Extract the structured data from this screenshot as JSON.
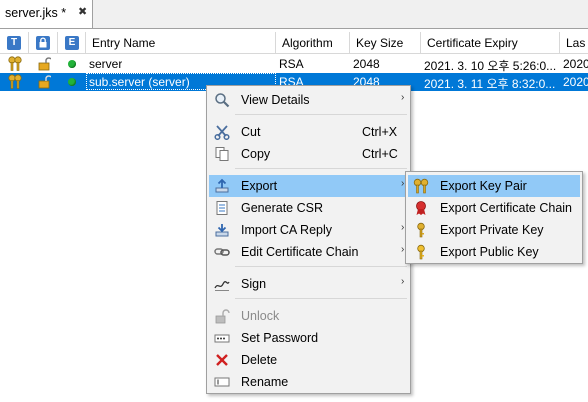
{
  "tab": {
    "title": "server.jks *",
    "close_glyph": "✖"
  },
  "columns": {
    "type_icon": "T",
    "lock_icon": "lock-icon",
    "expiry_icon": "E",
    "entry_name": "Entry Name",
    "algorithm": "Algorithm",
    "key_size": "Key Size",
    "cert_expiry": "Certificate Expiry",
    "last_modified": "Las"
  },
  "rows": [
    {
      "entry_name": "server",
      "algorithm": "RSA",
      "key_size": "2048",
      "cert_expiry": "2021. 3. 10 오후 5:26:0...",
      "last_modified": "2020",
      "selected": false
    },
    {
      "entry_name": "sub.server (server)",
      "algorithm": "RSA",
      "key_size": "2048",
      "cert_expiry": "2021. 3. 11 오후 8:32:0...",
      "last_modified": "2020",
      "selected": true
    }
  ],
  "context_menu": {
    "view_details": "View Details",
    "cut": "Cut",
    "cut_shortcut": "Ctrl+X",
    "copy": "Copy",
    "copy_shortcut": "Ctrl+C",
    "export": "Export",
    "generate_csr": "Generate CSR",
    "import_ca_reply": "Import CA Reply",
    "edit_cert_chain": "Edit Certificate Chain",
    "sign": "Sign",
    "unlock": "Unlock",
    "set_password": "Set Password",
    "delete": "Delete",
    "rename": "Rename",
    "submenu_arrow": "›"
  },
  "export_submenu": {
    "export_key_pair": "Export Key Pair",
    "export_cert_chain": "Export Certificate Chain",
    "export_private_key": "Export Private Key",
    "export_public_key": "Export Public Key"
  },
  "colors": {
    "selection": "#0078d7",
    "menu_highlight": "#91c9f7",
    "status_ok": "#22b33a",
    "key_gold": "#d8a520"
  }
}
